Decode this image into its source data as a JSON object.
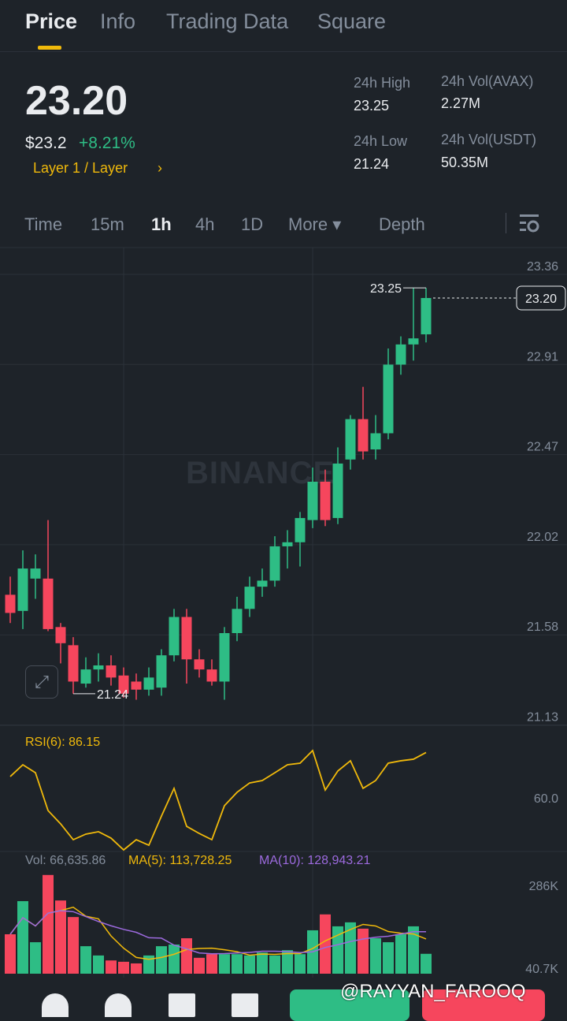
{
  "tabs": [
    "Price",
    "Info",
    "Trading Data",
    "Square"
  ],
  "header": {
    "price": "23.20",
    "usd": "$23.2",
    "change": "+8.21%",
    "tag": "Layer 1 / Layer",
    "tag_arrow": "›",
    "stats": {
      "high_label": "24h High",
      "high": "23.25",
      "low_label": "24h Low",
      "low": "21.24",
      "vol_base_label": "24h Vol(AVAX)",
      "vol_base": "2.27M",
      "vol_quote_label": "24h Vol(USDT)",
      "vol_quote": "50.35M"
    }
  },
  "intervals": {
    "time": "Time",
    "i15m": "15m",
    "i1h": "1h",
    "i4h": "4h",
    "i1d": "1D",
    "more": "More ▾",
    "depth": "Depth"
  },
  "colors": {
    "up": "#2ebd85",
    "down": "#f6465d",
    "accent": "#f0b90b",
    "ma10": "#9c6ade"
  },
  "watermark": "BINANCE",
  "overlay_text": "@RAYYAN_FAROOQ",
  "chart_data": {
    "type": "candlestick",
    "interval": "1h",
    "price_ticks": [
      "23.36",
      "22.91",
      "22.47",
      "22.02",
      "21.58",
      "21.13"
    ],
    "ylim": [
      21.13,
      23.36
    ],
    "last_price_label": "23.20",
    "high_marker": "23.25",
    "low_marker": "21.24",
    "candles": [
      [
        21.73,
        21.64,
        21.82,
        21.59
      ],
      [
        21.65,
        21.86,
        21.95,
        21.56
      ],
      [
        21.81,
        21.86,
        21.93,
        21.71
      ],
      [
        21.81,
        21.56,
        22.1,
        21.55
      ],
      [
        21.57,
        21.49,
        21.59,
        21.39
      ],
      [
        21.48,
        21.3,
        21.52,
        21.24
      ],
      [
        21.29,
        21.36,
        21.42,
        21.27
      ],
      [
        21.36,
        21.38,
        21.44,
        21.3
      ],
      [
        21.38,
        21.32,
        21.43,
        21.28
      ],
      [
        21.33,
        21.24,
        21.37,
        21.22
      ],
      [
        21.3,
        21.26,
        21.34,
        21.21
      ],
      [
        21.26,
        21.32,
        21.37,
        21.23
      ],
      [
        21.27,
        21.43,
        21.46,
        21.23
      ],
      [
        21.43,
        21.62,
        21.66,
        21.4
      ],
      [
        21.62,
        21.41,
        21.66,
        21.29
      ],
      [
        21.41,
        21.36,
        21.46,
        21.32
      ],
      [
        21.36,
        21.3,
        21.41,
        21.28
      ],
      [
        21.3,
        21.54,
        21.57,
        21.21
      ],
      [
        21.54,
        21.66,
        21.72,
        21.5
      ],
      [
        21.66,
        21.77,
        21.82,
        21.62
      ],
      [
        21.77,
        21.8,
        21.86,
        21.72
      ],
      [
        21.8,
        21.97,
        22.02,
        21.77
      ],
      [
        21.97,
        21.99,
        22.05,
        21.86
      ],
      [
        21.99,
        22.11,
        22.14,
        21.87
      ],
      [
        22.1,
        22.29,
        22.36,
        22.06
      ],
      [
        22.29,
        22.1,
        22.35,
        22.07
      ],
      [
        22.11,
        22.38,
        22.46,
        22.08
      ],
      [
        22.4,
        22.6,
        22.62,
        22.35
      ],
      [
        22.6,
        22.44,
        22.76,
        22.4
      ],
      [
        22.45,
        22.53,
        22.62,
        22.4
      ],
      [
        22.53,
        22.87,
        22.95,
        22.5
      ],
      [
        22.87,
        22.97,
        23.01,
        22.82
      ],
      [
        22.97,
        23.0,
        23.25,
        22.89
      ],
      [
        23.02,
        23.2,
        23.25,
        22.98
      ]
    ],
    "rsi": {
      "label": "RSI(6): 86.15",
      "tick": "60.0",
      "values": [
        72.3,
        79.1,
        74.5,
        52.7,
        45.0,
        35.9,
        39.1,
        40.5,
        36.8,
        30.0,
        35.9,
        32.7,
        49.5,
        65.5,
        43.6,
        39.5,
        35.9,
        55.5,
        63.2,
        68.6,
        70.0,
        74.5,
        79.1,
        80.0,
        87.3,
        64.5,
        75.5,
        81.4,
        65.5,
        70.0,
        80.0,
        81.4,
        82.3,
        86.15
      ]
    },
    "volume": {
      "vol_label": "Vol: 66,635.86",
      "ma5_label": "MA(5): 113,728.25",
      "ma10_label": "MA(10): 128,943.21",
      "ticks": [
        "286K",
        "40.7K"
      ],
      "unit": "K",
      "values": [
        119,
        219,
        95,
        298,
        221,
        171,
        83,
        55,
        40,
        36,
        31,
        55,
        83,
        88,
        107,
        48,
        59,
        59,
        59,
        55,
        64,
        55,
        71,
        59,
        131,
        179,
        143,
        155,
        136,
        107,
        95,
        119,
        143,
        60
      ]
    }
  }
}
